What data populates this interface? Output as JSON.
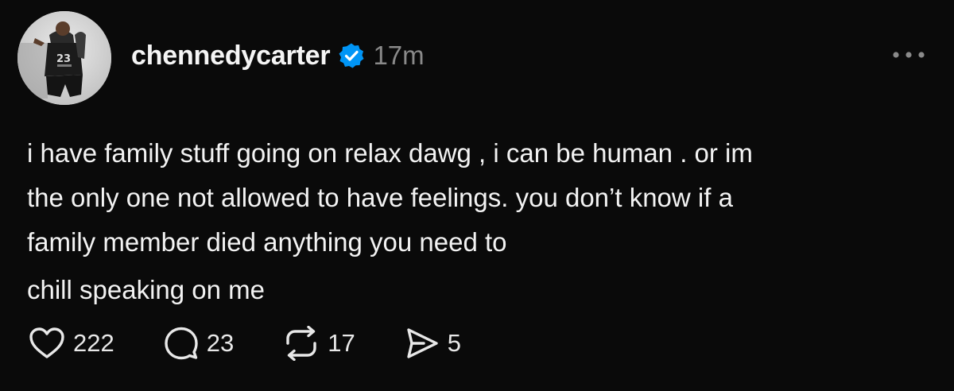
{
  "post": {
    "username": "chennedycarter",
    "timestamp": "17m",
    "verified": true,
    "text_lines": [
      "i have family stuff going on relax dawg , i can be human . or im",
      "the only one not allowed to have feelings. you don’t know if a",
      "family member died anything you need to",
      "chill speaking on me"
    ],
    "avatar_jersey_text": "23",
    "actions": {
      "likes": "222",
      "replies": "23",
      "reposts": "17",
      "shares": "5"
    }
  },
  "icons": {
    "verified": "verified-badge-icon",
    "more": "more-horizontal-icon",
    "like": "heart-icon",
    "reply": "speech-bubble-icon",
    "repost": "repost-arrows-icon",
    "share": "send-icon"
  },
  "colors": {
    "background": "#0a0a0a",
    "text": "#f3f3f3",
    "muted": "#8a8a8a",
    "verified_blue": "#0095f6"
  }
}
